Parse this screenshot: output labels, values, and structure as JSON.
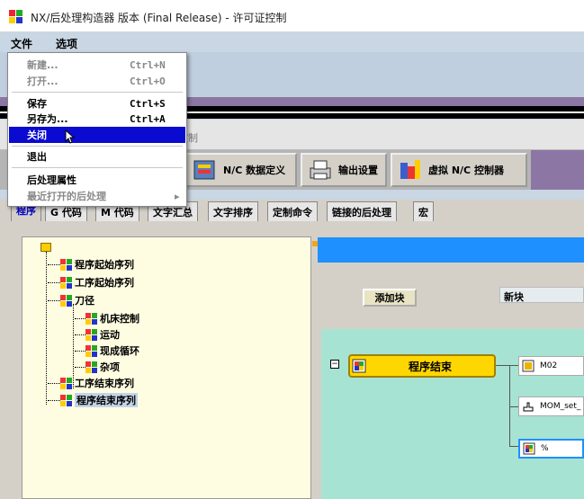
{
  "window": {
    "title": "NX/后处理构造器 版本 (Final Release) - 许可证控制"
  },
  "menubar": {
    "file": "文件",
    "options": "选项"
  },
  "file_menu": {
    "new": {
      "label": "新建...",
      "shortcut": "Ctrl+N"
    },
    "open": {
      "label": "打开...",
      "shortcut": "Ctrl+O"
    },
    "save": {
      "label": "保存",
      "shortcut": "Ctrl+S"
    },
    "save_as": {
      "label": "另存为...",
      "shortcut": "Ctrl+A"
    },
    "close": {
      "label": "关闭"
    },
    "exit": {
      "label": "退出"
    },
    "post_props": {
      "label": "后处理属性"
    },
    "recent": {
      "label": "最近打开的后处理",
      "arrow": "▸"
    }
  },
  "header": {
    "partial_label": "控制"
  },
  "big_tabs": {
    "nc_data": "N/C 数据定义",
    "output": "输出设置",
    "virtual_nc": "虚拟 N/C 控制器"
  },
  "tabs": [
    "程序",
    "G 代码",
    "M 代码",
    "文字汇总",
    "文字排序",
    "定制命令",
    "链接的后处理",
    "宏"
  ],
  "tree": {
    "items": [
      {
        "label": "程序起始序列"
      },
      {
        "label": "工序起始序列"
      },
      {
        "label": "刀径"
      },
      {
        "label": "机床控制"
      },
      {
        "label": "运动"
      },
      {
        "label": "现成循环"
      },
      {
        "label": "杂项"
      },
      {
        "label": "工序结束序列"
      },
      {
        "label": "程序结束序列"
      }
    ]
  },
  "right": {
    "add_block": "添加块",
    "new_block": "新块",
    "program_end": "程序结束",
    "collapse": "−",
    "blocks": [
      {
        "label": "M02"
      },
      {
        "label": "MOM_set_"
      },
      {
        "label": "%"
      }
    ]
  },
  "colors": {
    "accent_blue": "#1e90ff",
    "teal": "#a7e3d2",
    "highlight": "#0a0ad0",
    "yellow": "#ffd700"
  }
}
